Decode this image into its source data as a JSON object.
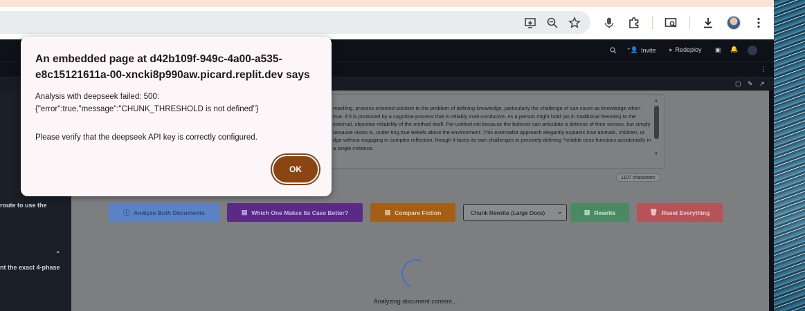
{
  "dialog": {
    "title": "An embedded page at d42b109f-949c-4a00-a535-e8c15121611a-00-xncki8p990aw.picard.replit.dev says",
    "message_line1": "Analysis with deepseek failed: 500:",
    "message_line2": "{\"error\":true,\"message\":\"CHUNK_THRESHOLD is not defined\"}",
    "hint": "Please verify that the deepseek API key is correctly configured.",
    "ok_label": "OK"
  },
  "replit_header": {
    "invite_label": "Invite",
    "redeploy_label": "Redeploy"
  },
  "left_panel": {
    "line1": "route to use the",
    "line2": "nt the exact 4-phase"
  },
  "document": {
    "text": "mpelling, process-oriented solution to the problem of defining knowledge, particularly the challenge of can count as knowledge when true, if it is produced by a cognitive process that is reliably truth-conducive. ns a person might hold (as in traditional theories) to the external, objective reliability of the method itself. For ustified not because the believer can articulate a defense of their senses, but simply because vision is, under ting true beliefs about the environment. This externalist approach elegantly explains how animals, children, or dge without engaging in complex reflection, though it faces its own challenges in precisely defining \"reliable cess functions accidentally in a single instance.",
    "char_count": "1107 characters"
  },
  "actions": {
    "analyze_both": "Analyze Both Documents",
    "which_one": "Which One Makes Its Case Better?",
    "compare_fiction": "Compare Fiction",
    "chunk_select": "Chunk Rewrite (Large Docs)",
    "rewrite": "Rewrite",
    "reset": "Reset Everything"
  },
  "status": {
    "loading_text": "Analyzing document content..."
  },
  "colors": {
    "ok_button": "#8b4513",
    "analyze_button": "#5b82c4",
    "which_button": "#5b2a86",
    "compare_button": "#a45f14",
    "rewrite_button": "#4a8a62",
    "reset_button": "#b65358",
    "spinner": "#3d6fd1"
  },
  "icons": {
    "install": "install-app-icon",
    "zoom": "zoom-icon",
    "bookmark": "star-icon",
    "voice": "microphone-icon",
    "extensions": "puzzle-icon",
    "cast": "search-tab-icon",
    "downloads": "download-icon",
    "menu": "kebab-menu-icon"
  }
}
